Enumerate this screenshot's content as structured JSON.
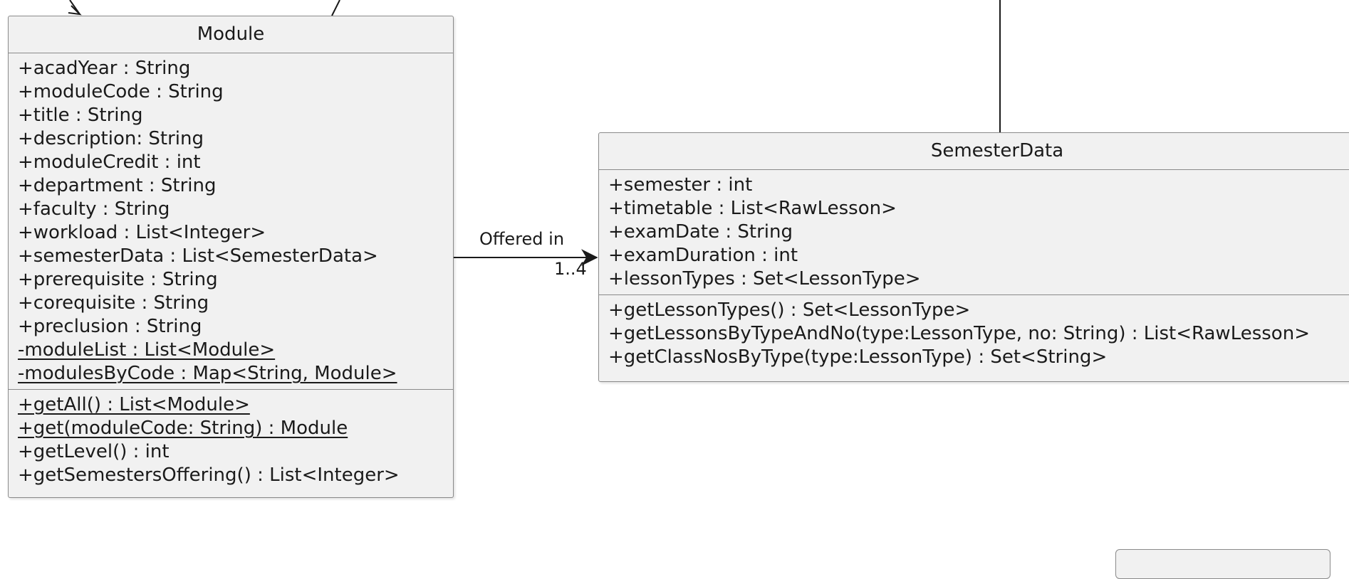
{
  "classes": {
    "module": {
      "name": "Module",
      "attributes": [
        {
          "text": "+acadYear : String",
          "static": false
        },
        {
          "text": "+moduleCode : String",
          "static": false
        },
        {
          "text": "+title : String",
          "static": false
        },
        {
          "text": "+description: String",
          "static": false
        },
        {
          "text": "+moduleCredit : int",
          "static": false
        },
        {
          "text": "+department : String",
          "static": false
        },
        {
          "text": "+faculty : String",
          "static": false
        },
        {
          "text": "+workload : List<Integer>",
          "static": false
        },
        {
          "text": "+semesterData : List<SemesterData>",
          "static": false
        },
        {
          "text": "+prerequisite : String",
          "static": false
        },
        {
          "text": "+corequisite : String",
          "static": false
        },
        {
          "text": "+preclusion : String",
          "static": false
        },
        {
          "text": "-moduleList : List<Module>",
          "static": true
        },
        {
          "text": "-modulesByCode : Map<String, Module>",
          "static": true
        }
      ],
      "methods": [
        {
          "text": "+getAll() : List<Module>",
          "static": true
        },
        {
          "text": "+get(moduleCode: String) : Module",
          "static": true
        },
        {
          "text": "+getLevel() : int",
          "static": false
        },
        {
          "text": "+getSemestersOffering() : List<Integer>",
          "static": false
        }
      ]
    },
    "semester_data": {
      "name": "SemesterData",
      "attributes": [
        {
          "text": "+semester : int",
          "static": false
        },
        {
          "text": "+timetable : List<RawLesson>",
          "static": false
        },
        {
          "text": "+examDate : String",
          "static": false
        },
        {
          "text": "+examDuration : int",
          "static": false
        },
        {
          "text": "+lessonTypes : Set<LessonType>",
          "static": false
        }
      ],
      "methods": [
        {
          "text": "+getLessonTypes() : Set<LessonType>",
          "static": false
        },
        {
          "text": "+getLessonsByTypeAndNo(type:LessonType, no: String) : List<RawLesson>",
          "static": false
        },
        {
          "text": "+getClassNosByType(type:LessonType) : Set<String>",
          "static": false
        }
      ]
    }
  },
  "association": {
    "label": "Offered in",
    "multiplicity": "1..4"
  },
  "colors": {
    "class_fill": "#f1f1f1",
    "class_border": "#8a8a8a",
    "line": "#1a1a1a",
    "text": "#1a1a1a"
  }
}
